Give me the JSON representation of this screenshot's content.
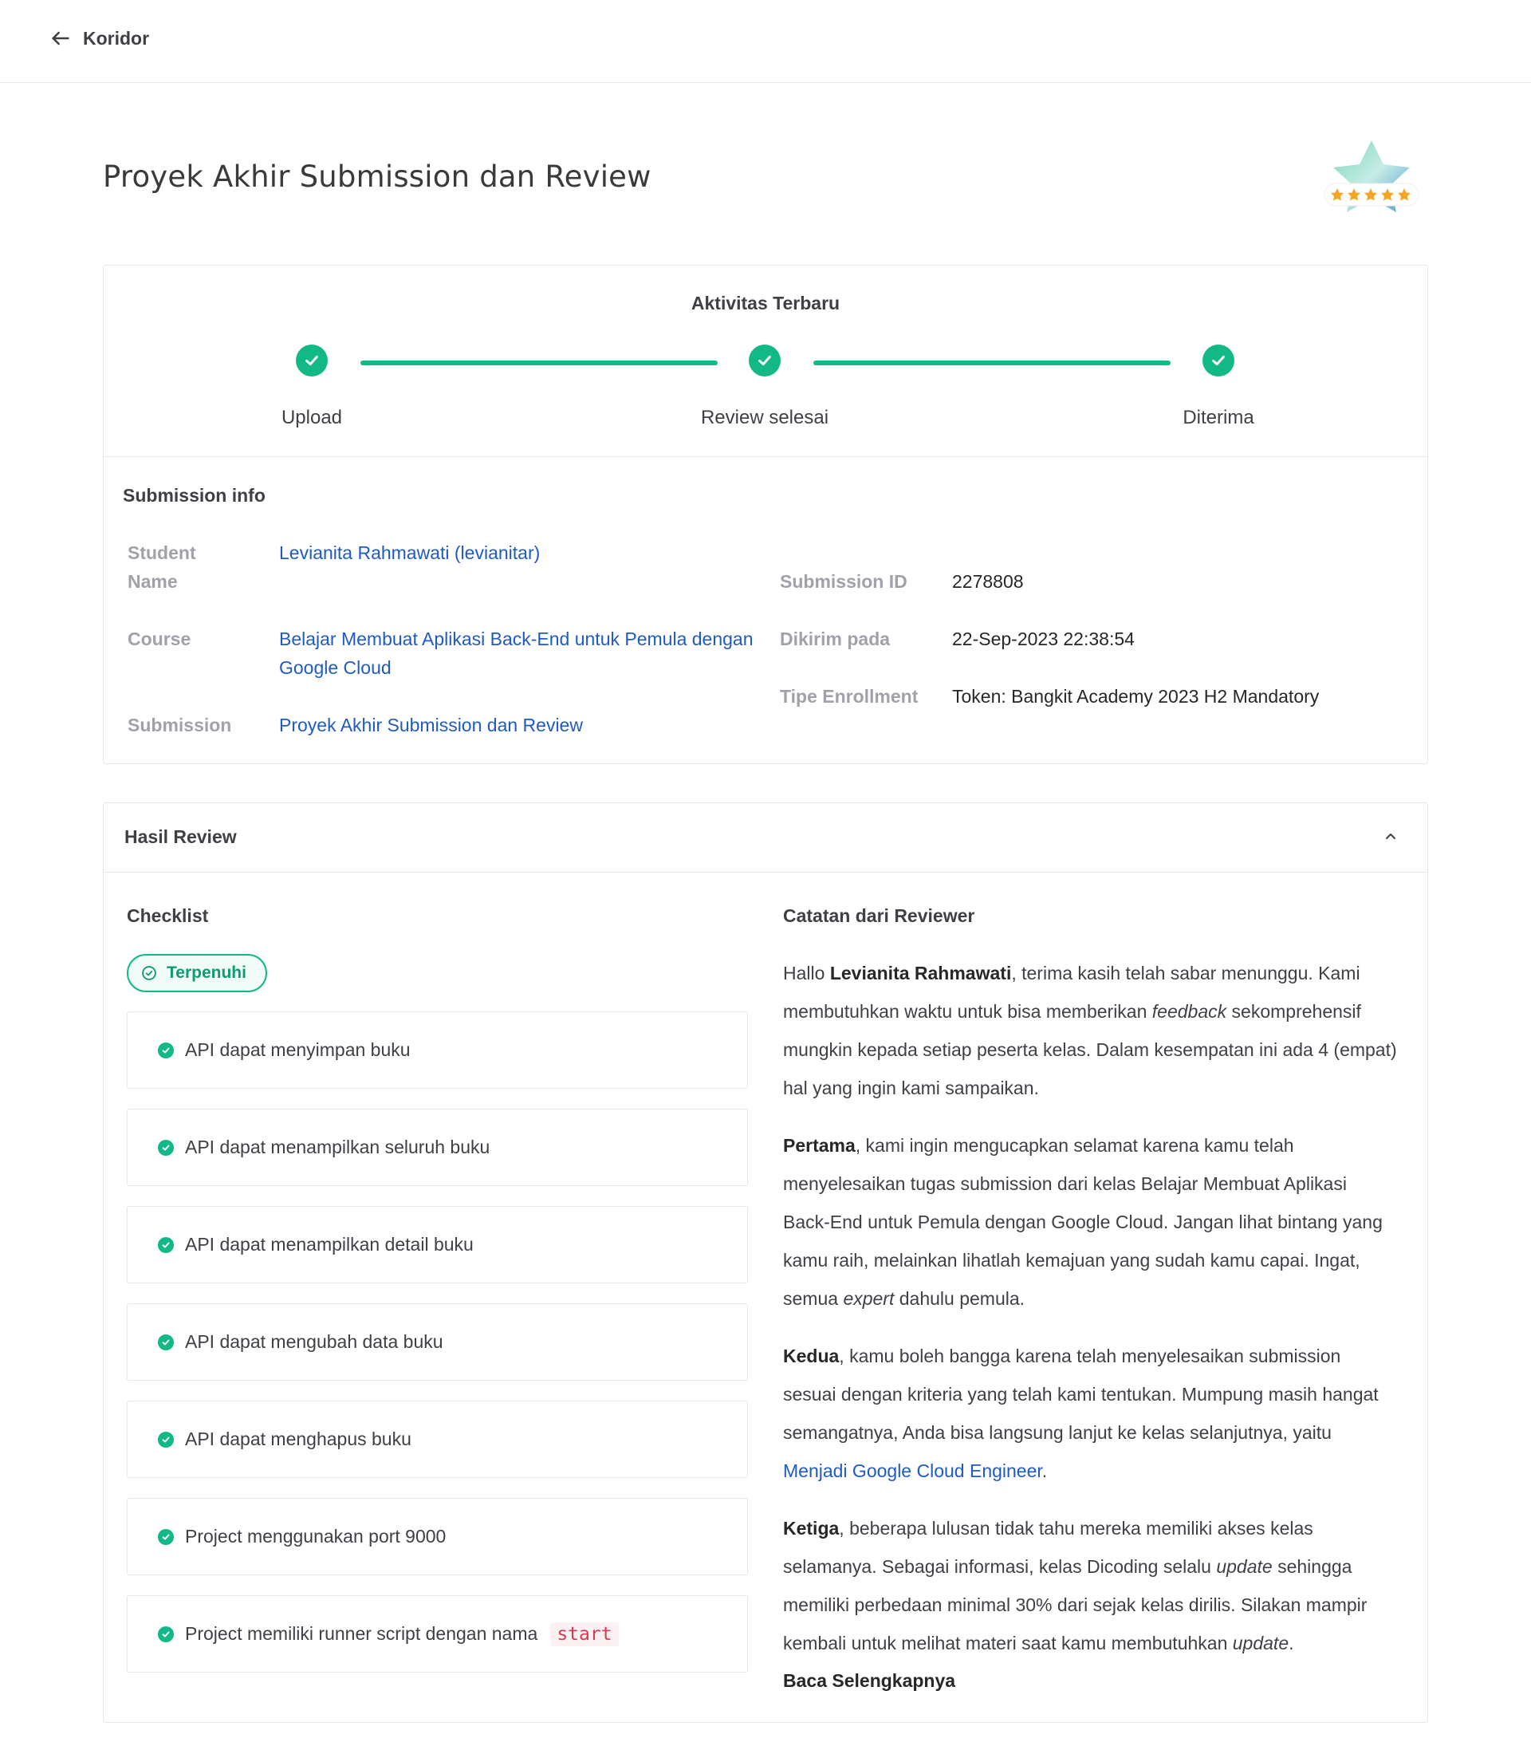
{
  "nav": {
    "back_label": "Koridor"
  },
  "page": {
    "title": "Proyek Akhir Submission dan Review"
  },
  "activity": {
    "title": "Aktivitas Terbaru",
    "steps": [
      {
        "label": "Upload"
      },
      {
        "label": "Review selesai"
      },
      {
        "label": "Diterima"
      }
    ]
  },
  "submission_info": {
    "title": "Submission info",
    "student_name_label": "Student Name",
    "student_name_value": "Levianita Rahmawati (levianitar)",
    "course_label": "Course",
    "course_value": "Belajar Membuat Aplikasi Back-End untuk Pemula dengan Google Cloud",
    "submission_label": "Submission",
    "submission_value": "Proyek Akhir Submission dan Review",
    "submission_id_label": "Submission ID",
    "submission_id_value": "2278808",
    "sent_label": "Dikirim pada",
    "sent_value": "22-Sep-2023 22:38:54",
    "enrollment_label": "Tipe Enrollment",
    "enrollment_value": "Token: Bangkit Academy 2023 H2 Mandatory"
  },
  "review": {
    "title": "Hasil Review",
    "checklist_title": "Checklist",
    "status_badge": "Terpenuhi",
    "checklist": [
      {
        "text": "API dapat menyimpan buku"
      },
      {
        "text": "API dapat menampilkan seluruh buku"
      },
      {
        "text": "API dapat menampilkan detail buku"
      },
      {
        "text": "API dapat mengubah data buku"
      },
      {
        "text": "API dapat menghapus buku"
      },
      {
        "text": "Project menggunakan port 9000"
      },
      {
        "text": "Project memiliki runner script dengan nama",
        "code": "start"
      }
    ],
    "notes_title": "Catatan dari Reviewer",
    "notes": {
      "p1_a": "Hallo ",
      "p1_name": "Levianita Rahmawati",
      "p1_b": ", terima kasih telah sabar menunggu. Kami membutuhkan waktu untuk bisa memberikan ",
      "p1_em": "feedback",
      "p1_c": " sekomprehensif mungkin kepada setiap peserta kelas. Dalam kesempatan ini ada 4 (empat) hal yang ingin kami sampaikan.",
      "p2_b": "Pertama",
      "p2_a": ", kami ingin mengucapkan selamat karena kamu telah menyelesaikan tugas submission dari kelas Belajar Membuat Aplikasi Back-End untuk Pemula dengan Google Cloud. Jangan lihat bintang yang kamu raih, melainkan lihatlah kemajuan yang sudah kamu capai. Ingat, semua ",
      "p2_em": "expert",
      "p2_c": " dahulu pemula.",
      "p3_b": "Kedua",
      "p3_a": ", kamu boleh bangga karena telah menyelesaikan submission sesuai dengan kriteria yang telah kami tentukan. Mumpung masih hangat semangatnya, Anda bisa langsung lanjut ke kelas selanjutnya, yaitu ",
      "p3_link": "Menjadi Google Cloud Engineer",
      "p3_c": ".",
      "p4_b": "Ketiga",
      "p4_a": ", beberapa lulusan tidak tahu mereka memiliki akses kelas selamanya. Sebagai informasi, kelas Dicoding selalu ",
      "p4_em": "update",
      "p4_c": " sehingga memiliki perbedaan minimal 30% dari sejak kelas dirilis. Silakan mampir kembali untuk melihat materi saat kamu membutuhkan ",
      "p4_em2": "update",
      "p4_d": "."
    },
    "read_more": "Baca Selengkapnya"
  },
  "colors": {
    "accent": "#12b886",
    "link": "#1e5bc6",
    "code": "#d63a56"
  }
}
